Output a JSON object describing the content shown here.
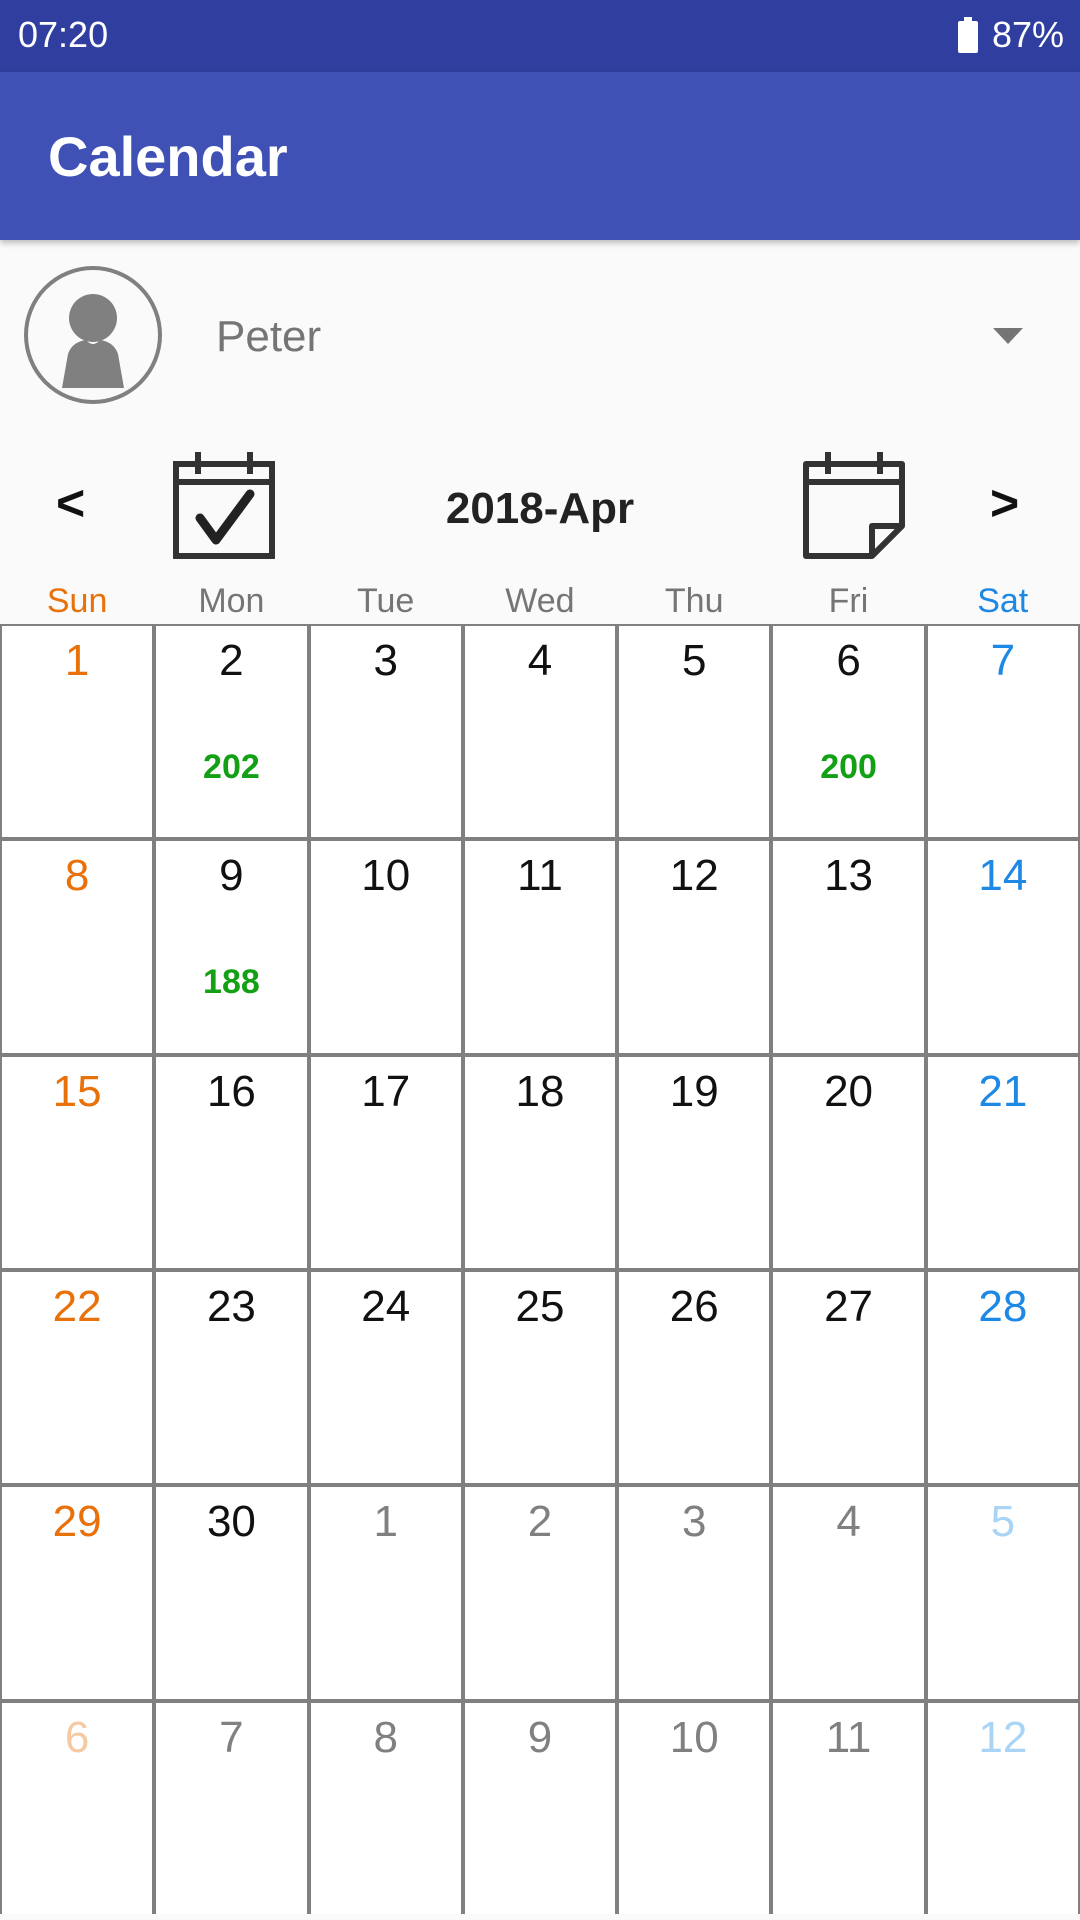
{
  "status_bar": {
    "time": "07:20",
    "battery": "87%"
  },
  "app_bar": {
    "title": "Calendar"
  },
  "user": {
    "name": "Peter"
  },
  "nav": {
    "prev": "<",
    "next": ">",
    "month_title": "2018-Apr"
  },
  "weekdays": [
    "Sun",
    "Mon",
    "Tue",
    "Wed",
    "Thu",
    "Fri",
    "Sat"
  ],
  "colors": {
    "status_bar": "#303f9f",
    "app_bar": "#3f51b5",
    "sunday": "#e8710a",
    "saturday": "#1e88e5",
    "event_count": "#14a014"
  },
  "weeks": [
    [
      {
        "day": "1"
      },
      {
        "day": "2",
        "count": "202"
      },
      {
        "day": "3"
      },
      {
        "day": "4"
      },
      {
        "day": "5"
      },
      {
        "day": "6",
        "count": "200"
      },
      {
        "day": "7"
      }
    ],
    [
      {
        "day": "8"
      },
      {
        "day": "9",
        "count": "188"
      },
      {
        "day": "10"
      },
      {
        "day": "11"
      },
      {
        "day": "12"
      },
      {
        "day": "13"
      },
      {
        "day": "14"
      }
    ],
    [
      {
        "day": "15"
      },
      {
        "day": "16"
      },
      {
        "day": "17"
      },
      {
        "day": "18"
      },
      {
        "day": "19"
      },
      {
        "day": "20"
      },
      {
        "day": "21"
      }
    ],
    [
      {
        "day": "22"
      },
      {
        "day": "23"
      },
      {
        "day": "24"
      },
      {
        "day": "25"
      },
      {
        "day": "26"
      },
      {
        "day": "27"
      },
      {
        "day": "28"
      }
    ],
    [
      {
        "day": "29"
      },
      {
        "day": "30"
      },
      {
        "day": "1",
        "other": true
      },
      {
        "day": "2",
        "other": true
      },
      {
        "day": "3",
        "other": true
      },
      {
        "day": "4",
        "other": true
      },
      {
        "day": "5",
        "other": true
      }
    ],
    [
      {
        "day": "6",
        "other": true
      },
      {
        "day": "7",
        "other": true
      },
      {
        "day": "8",
        "other": true
      },
      {
        "day": "9",
        "other": true
      },
      {
        "day": "10",
        "other": true
      },
      {
        "day": "11",
        "other": true
      },
      {
        "day": "12",
        "other": true
      }
    ]
  ]
}
